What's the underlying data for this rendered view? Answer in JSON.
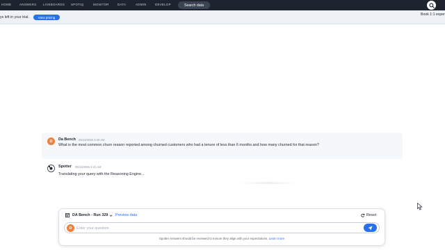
{
  "nav": {
    "items": [
      "HOME",
      "ANSWERS",
      "LIVEBOARDS",
      "SPOTIQ",
      "MONITOR",
      "DATA",
      "ADMIN",
      "DEVELOP"
    ],
    "search_label": "Search data",
    "search_icon": "search-icon"
  },
  "trial": {
    "text": "ys left in your trial.",
    "pricing_label": "View pricing",
    "book_text": "Book 1:1 exper"
  },
  "conversation": {
    "user_message": {
      "avatar_initial": "D",
      "author": "Da Bench",
      "timestamp": "06/13/2025 3:40 AM",
      "text": "What is the most common churn reason reported among churned customers who had a tenure of less than 6 months and how many churned for that reason?"
    },
    "assistant_message": {
      "author": "Spotter",
      "timestamp": "06/13/2025 3:41 AM",
      "text": "Translating your query with the Reasoning Engine..."
    }
  },
  "composer": {
    "model_label": "DA Bench - Run 329",
    "preview_label": "Preview data",
    "reset_label": "Reset",
    "avatar_initial": "D",
    "input_placeholder": "Enter your question",
    "input_value": "",
    "disclaimer": "Spotter Answers should be reviewed to ensure they align with your expectations.",
    "learn_more": "Learn more"
  },
  "colors": {
    "nav_bg": "#1d232f",
    "accent": "#2770ef",
    "avatar": "#f0803c",
    "user_msg_bg": "#f4f8fb"
  }
}
